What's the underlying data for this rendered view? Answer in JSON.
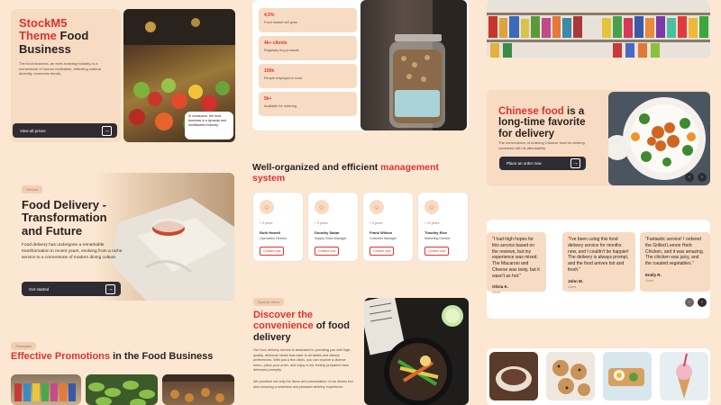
{
  "hero": {
    "title_brand": "StockM5",
    "title_theme": "Theme",
    "title_rest_1": "Food",
    "title_rest_2": "Business",
    "body": "The food business, an ever-evolving industry, is a cornerstone of human civilization, reflecting cultural diversity, economic trends.",
    "button": "View all prices",
    "caption": "In conclusion, the food business is a dynamic and multifaceted industry."
  },
  "stats": [
    {
      "value": "4,5%",
      "label": "Food market will grow"
    },
    {
      "value": "4k+ clients",
      "label": "Regularly buy products"
    },
    {
      "value": "100k",
      "label": "People employed in food"
    },
    {
      "value": "5k+",
      "label": "Available for ordering"
    }
  ],
  "chinese": {
    "red": "Chinese food",
    "rest1": " is a",
    "line2": "long-time favorite",
    "line3": "for delivery",
    "body": "The convenience of ordering Chinese food for delivery, combined with its affordability.",
    "button": "Place an order now",
    "prev": "‹",
    "next": "›"
  },
  "delivery": {
    "pill": "Service",
    "title": "Food Delivery - Transformation and Future",
    "body": "Food delivery has undergone a remarkable transformation in recent years, evolving from a niche service to a cornerstone of modern dining culture.",
    "button": "Get started"
  },
  "management": {
    "title_dark": "Well-organized and efficient ",
    "title_red": "management system",
    "people": [
      {
        "years": "+ 5 years",
        "name": "Ruth Howell",
        "role": "Operations Director",
        "contact": "Contact now"
      },
      {
        "years": "+ 5 years",
        "name": "Dorothy Sabar",
        "role": "Supply Chain Manager",
        "contact": "Contact now"
      },
      {
        "years": "+ 6 years",
        "name": "Frank Wilson",
        "role": "Customer Manager",
        "contact": "Contact now"
      },
      {
        "years": "+ 10 years",
        "name": "Timothy Rice",
        "role": "Marketing Director",
        "contact": "Contact now"
      }
    ]
  },
  "reviews": [
    {
      "text": "\"I had high hopes for this service based on the reviews, but my experience was mixed. The Macaroni and Cheese was tasty, but it wasn't as hot.\"",
      "name": "Olivia K.",
      "role": "Client"
    },
    {
      "text": "\"I've been using this food delivery service for months now, and I couldn't be happier! The delivery is always prompt, and the food arrives hot and fresh.\"",
      "name": "John M.",
      "role": "Client"
    },
    {
      "text": "\"Fantastic service! I ordered the Grilled Lemon Herb Chicken, and it was amazing. The chicken was juicy, and the roasted vegetables.\"",
      "name": "Emily R.",
      "role": "Client"
    }
  ],
  "reviews_nav": {
    "prev": "‹",
    "next": "›"
  },
  "discover": {
    "pill": "Special offers",
    "red": "Discover the convenience",
    "rest": " of food delivery",
    "body1": "Our food delivery service is dedicated to providing you with high-quality, delicious meals that cater to all tastes and dietary preferences. With just a few clicks, you can explore a diverse menu, place your order, and enjoy a hot, freshly prepared meal delivered promptly.",
    "body2": "We prioritize not only the flavor and presentation of our dishes but also ensuring a seamless and pleasant delivery experience."
  },
  "promotions": {
    "pill": "Strategies",
    "red": "Effective Promotions",
    "rest": " in the Food Business"
  }
}
